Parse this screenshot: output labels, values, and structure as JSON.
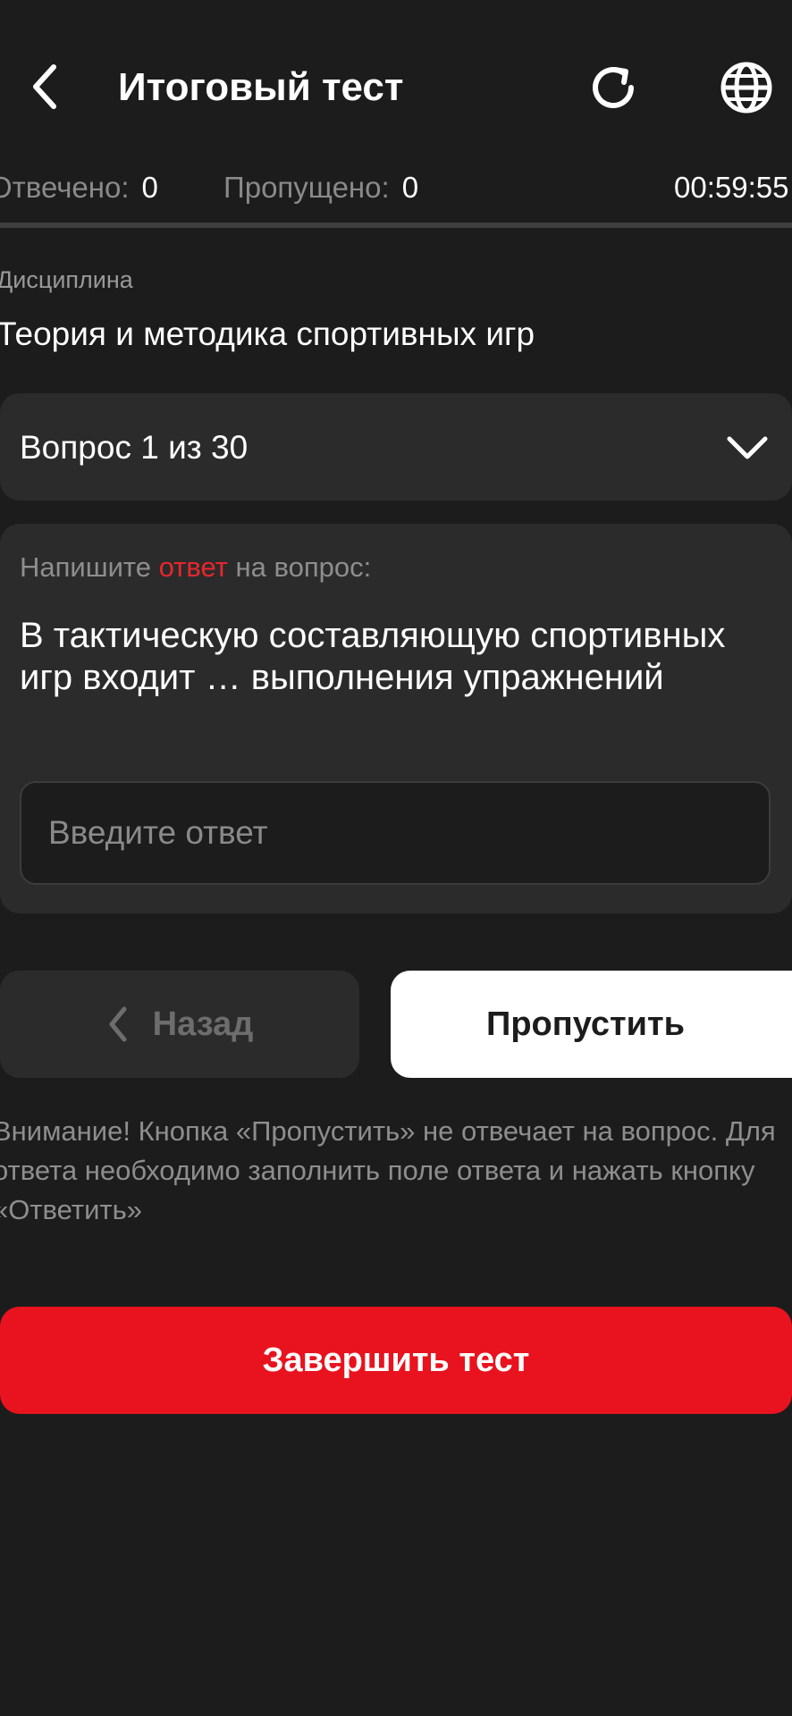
{
  "header": {
    "title": "Итоговый тест"
  },
  "stats": {
    "answered_label": "Отвечено:",
    "answered_value": "0",
    "skipped_label": "Пропущено:",
    "skipped_value": "0",
    "timer": "00:59:55",
    "progress_fraction": 0
  },
  "discipline": {
    "label": "Дисциплина",
    "name": "Теория и методика спортивных игр"
  },
  "question_selector": {
    "label": "Вопрос 1 из 30"
  },
  "question": {
    "prompt_before": "Напишите ",
    "prompt_accent": "ответ",
    "prompt_after": " на вопрос:",
    "text": "В тактическую составляющую спортивных игр входит … выполнения упражнений",
    "input_placeholder": "Введите ответ",
    "input_value": ""
  },
  "buttons": {
    "back_label": "Назад",
    "skip_label": "Пропустить",
    "finish_label": "Завершить тест"
  },
  "notice": "Внимание! Кнопка «Пропустить» не отвечает на вопрос. Для ответа необходимо заполнить поле ответа и нажать кнопку «Ответить»",
  "colors": {
    "background": "#1c1c1c",
    "card": "#2b2b2b",
    "accent_red": "#e8131e",
    "muted_text": "#8e8e8e"
  },
  "icons": {
    "back": "chevron-left-icon",
    "refresh": "refresh-icon",
    "language": "globe-icon",
    "dropdown": "chevron-down-icon",
    "back_button": "chevron-left-icon"
  }
}
